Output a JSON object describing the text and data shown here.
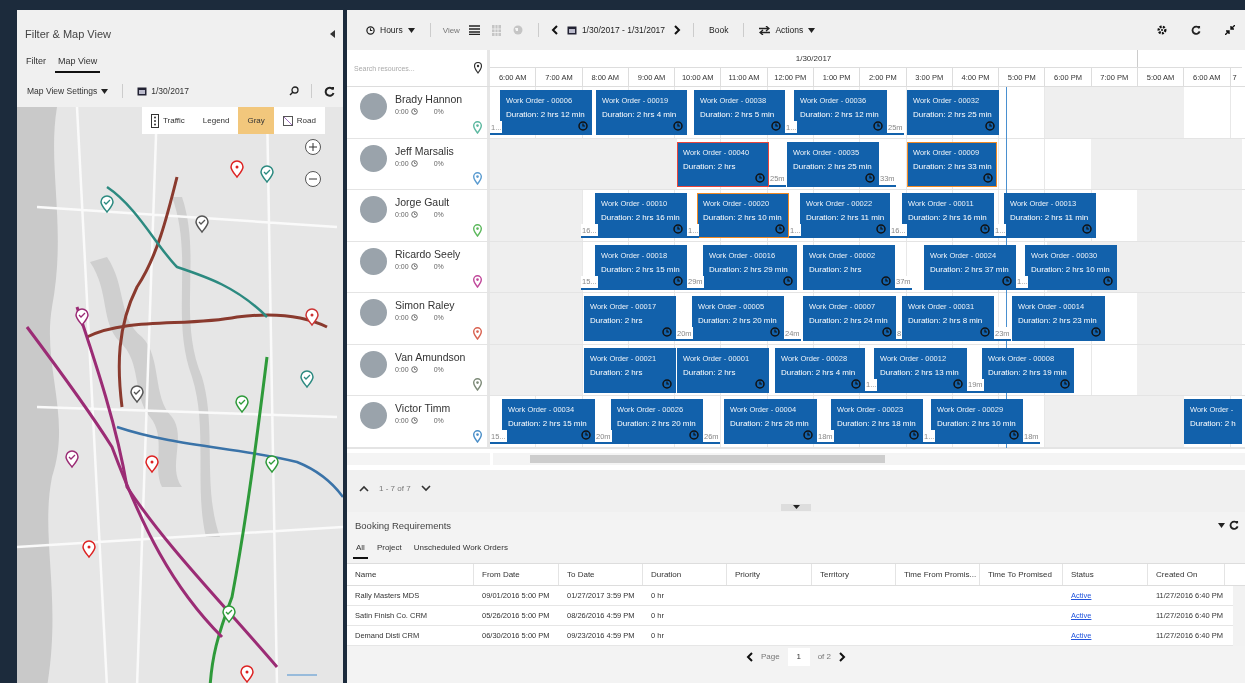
{
  "filter_panel": {
    "title": "Filter & Map View",
    "tabs": [
      {
        "label": "Filter",
        "selected": false
      },
      {
        "label": "Map View",
        "selected": true
      }
    ],
    "settings_label": "Map View Settings",
    "date": "1/30/2017",
    "map_toolbar": [
      {
        "kind": "traffic",
        "label": "Traffic",
        "selected": false
      },
      {
        "kind": "text",
        "label": "Legend",
        "selected": false
      },
      {
        "kind": "text",
        "label": "Gray",
        "selected": true
      },
      {
        "kind": "road",
        "label": "Road",
        "selected": false
      }
    ]
  },
  "scheduler": {
    "toolbar": {
      "view_mode": "Hours",
      "view_label": "View",
      "view_buttons": [
        {
          "kind": "list",
          "disabled": false
        },
        {
          "kind": "grid",
          "disabled": true
        },
        {
          "kind": "globe",
          "disabled": true
        }
      ],
      "date_range": "1/30/2017 - 1/31/2017",
      "book": "Book",
      "actions": "Actions"
    },
    "search": {
      "placeholder": "Search resources..."
    },
    "date_header": "1/30/2017",
    "hours": [
      "6:00 AM",
      "7:00 AM",
      "8:00 AM",
      "9:00 AM",
      "10:00 AM",
      "11:00 AM",
      "12:00 PM",
      "1:00 PM",
      "2:00 PM",
      "3:00 PM",
      "4:00 PM",
      "5:00 PM",
      "6:00 PM",
      "7:00 PM",
      "5:00 AM",
      "6:00 AM",
      "7"
    ],
    "resources": [
      {
        "name": "Brady Hannon",
        "hours": "0:00",
        "utilization": "0%",
        "color": "#5cb8a0",
        "bookings": [
          {
            "title": "Work Order - 00006",
            "duration": "Duration: 2 hrs 12 min",
            "travel": "1..."
          },
          {
            "title": "Work Order - 00019",
            "duration": "Duration: 2 hrs 4 min"
          },
          {
            "title": "Work Order - 00038",
            "duration": "Duration: 2 hrs 5 min"
          },
          {
            "title": "Work Order - 00036",
            "duration": "Duration: 2 hrs 12 min",
            "travel": "1..."
          },
          {
            "title": "Work Order - 00032",
            "duration": "Duration: 2 hrs 25 min",
            "travel": "25m"
          }
        ]
      },
      {
        "name": "Jeff Marsalis",
        "hours": "0:00",
        "utilization": "0%",
        "color": "#5a9bd0",
        "bookings": [
          {
            "title": "Work Order - 00040",
            "duration": "Duration: 2 hrs",
            "color": "#e8453c"
          },
          {
            "title": "Work Order - 00035",
            "duration": "Duration: 2 hrs 25 min",
            "travel": "25m"
          },
          {
            "title": "Work Order - 00009",
            "duration": "Duration: 2 hrs 33 min",
            "travel": "33m",
            "color": "#f08a24"
          }
        ]
      },
      {
        "name": "Jorge Gault",
        "hours": "0:00",
        "utilization": "0%",
        "color": "#5cb85c",
        "bookings": [
          {
            "title": "Work Order - 00010",
            "duration": "Duration: 2 hrs 16 min",
            "travel": "16..."
          },
          {
            "title": "Work Order - 00020",
            "duration": "Duration: 2 hrs 10 min",
            "travel": "1...",
            "color": "#f08a24"
          },
          {
            "title": "Work Order - 00022",
            "duration": "Duration: 2 hrs 11 min",
            "travel": "1..."
          },
          {
            "title": "Work Order - 00011",
            "duration": "Duration: 2 hrs 16 min",
            "travel": "16..."
          },
          {
            "title": "Work Order - 00013",
            "duration": "Duration: 2 hrs 11 min",
            "travel": "1..."
          }
        ]
      },
      {
        "name": "Ricardo Seely",
        "hours": "0:00",
        "utilization": "0%",
        "color": "#c0479a",
        "bookings": [
          {
            "title": "Work Order - 00018",
            "duration": "Duration: 2 hrs 15 min",
            "travel": "15..."
          },
          {
            "title": "Work Order - 00016",
            "duration": "Duration: 2 hrs 29 min",
            "travel": "29m"
          },
          {
            "title": "Work Order - 00002",
            "duration": "Duration: 2 hrs"
          },
          {
            "title": "Work Order - 00024",
            "duration": "Duration: 2 hrs 37 min",
            "travel": "37m"
          },
          {
            "title": "Work Order - 00030",
            "duration": "Duration: 2 hrs 10 min",
            "travel": "1..."
          }
        ]
      },
      {
        "name": "Simon Raley",
        "hours": "0:00",
        "utilization": "0%",
        "color": "#d9614f",
        "bookings": [
          {
            "title": "Work Order - 00017",
            "duration": "Duration: 2 hrs"
          },
          {
            "title": "Work Order - 00005",
            "duration": "Duration: 2 hrs 20 min",
            "travel": "20m"
          },
          {
            "title": "Work Order - 00007",
            "duration": "Duration: 2 hrs 24 min",
            "travel": "24m"
          },
          {
            "title": "Work Order - 00031",
            "duration": "Duration: 2 hrs 8 min",
            "travel": "8"
          },
          {
            "title": "Work Order - 00014",
            "duration": "Duration: 2 hrs 23 min",
            "travel": "23m"
          }
        ]
      },
      {
        "name": "Van Amundson",
        "hours": "0:00",
        "utilization": "0%",
        "color": "#7d8a78",
        "bookings": [
          {
            "title": "Work Order - 00021",
            "duration": "Duration: 2 hrs"
          },
          {
            "title": "Work Order - 00001",
            "duration": "Duration: 2 hrs"
          },
          {
            "title": "Work Order - 00028",
            "duration": "Duration: 2 hrs 4 min"
          },
          {
            "title": "Work Order - 00012",
            "duration": "Duration: 2 hrs 13 min",
            "travel": "1..."
          },
          {
            "title": "Work Order - 00008",
            "duration": "Duration: 2 hrs 19 min",
            "travel": "19m"
          }
        ]
      },
      {
        "name": "Victor Timm",
        "hours": "0:00",
        "utilization": "0%",
        "color": "#4a8ec8",
        "bookings": [
          {
            "title": "Work Order - 00034",
            "duration": "Duration: 2 hrs 15 min",
            "travel": "15..."
          },
          {
            "title": "Work Order - 00026",
            "duration": "Duration: 2 hrs 20 min",
            "travel": "20m"
          },
          {
            "title": "Work Order - 00004",
            "duration": "Duration: 2 hrs 26 min",
            "travel": "26m"
          },
          {
            "title": "Work Order - 00023",
            "duration": "Duration: 2 hrs 18 min",
            "travel": "18m"
          },
          {
            "title": "Work Order - 00029",
            "duration": "Duration: 2 hrs 10 min",
            "travel": "1..."
          },
          {
            "title": "Work Order -",
            "duration": "Duration: 2 h",
            "travel": "18m"
          }
        ]
      }
    ],
    "pager": "1 - 7 of 7"
  },
  "booking_requirements": {
    "title": "Booking Requirements",
    "tabs": [
      {
        "label": "All",
        "selected": true
      },
      {
        "label": "Project",
        "selected": false
      },
      {
        "label": "Unscheduled Work Orders",
        "selected": false
      }
    ],
    "columns": [
      "Name",
      "From Date",
      "To Date",
      "Duration",
      "Priority",
      "Territory",
      "Time From Promis...",
      "Time To Promised",
      "Status",
      "Created On"
    ],
    "rows": [
      [
        "Rally Masters MDS",
        "09/01/2016 5:00 PM",
        "01/27/2017 3:59 PM",
        "0 hr",
        "",
        "",
        "",
        "",
        "Active",
        "11/27/2016 6:40 PM"
      ],
      [
        "Satin Finish Co. CRM",
        "05/26/2016 5:00 PM",
        "08/26/2016 4:59 PM",
        "0 hr",
        "",
        "",
        "",
        "",
        "Active",
        "11/27/2016 6:40 PM"
      ],
      [
        "Demand Disti CRM",
        "06/30/2016 5:00 PM",
        "09/23/2016 4:59 PM",
        "0 hr",
        "",
        "",
        "",
        "",
        "Active",
        "11/27/2016 6:40 PM"
      ]
    ],
    "page_label": "Page",
    "page": "1",
    "page_total": "of 2"
  }
}
